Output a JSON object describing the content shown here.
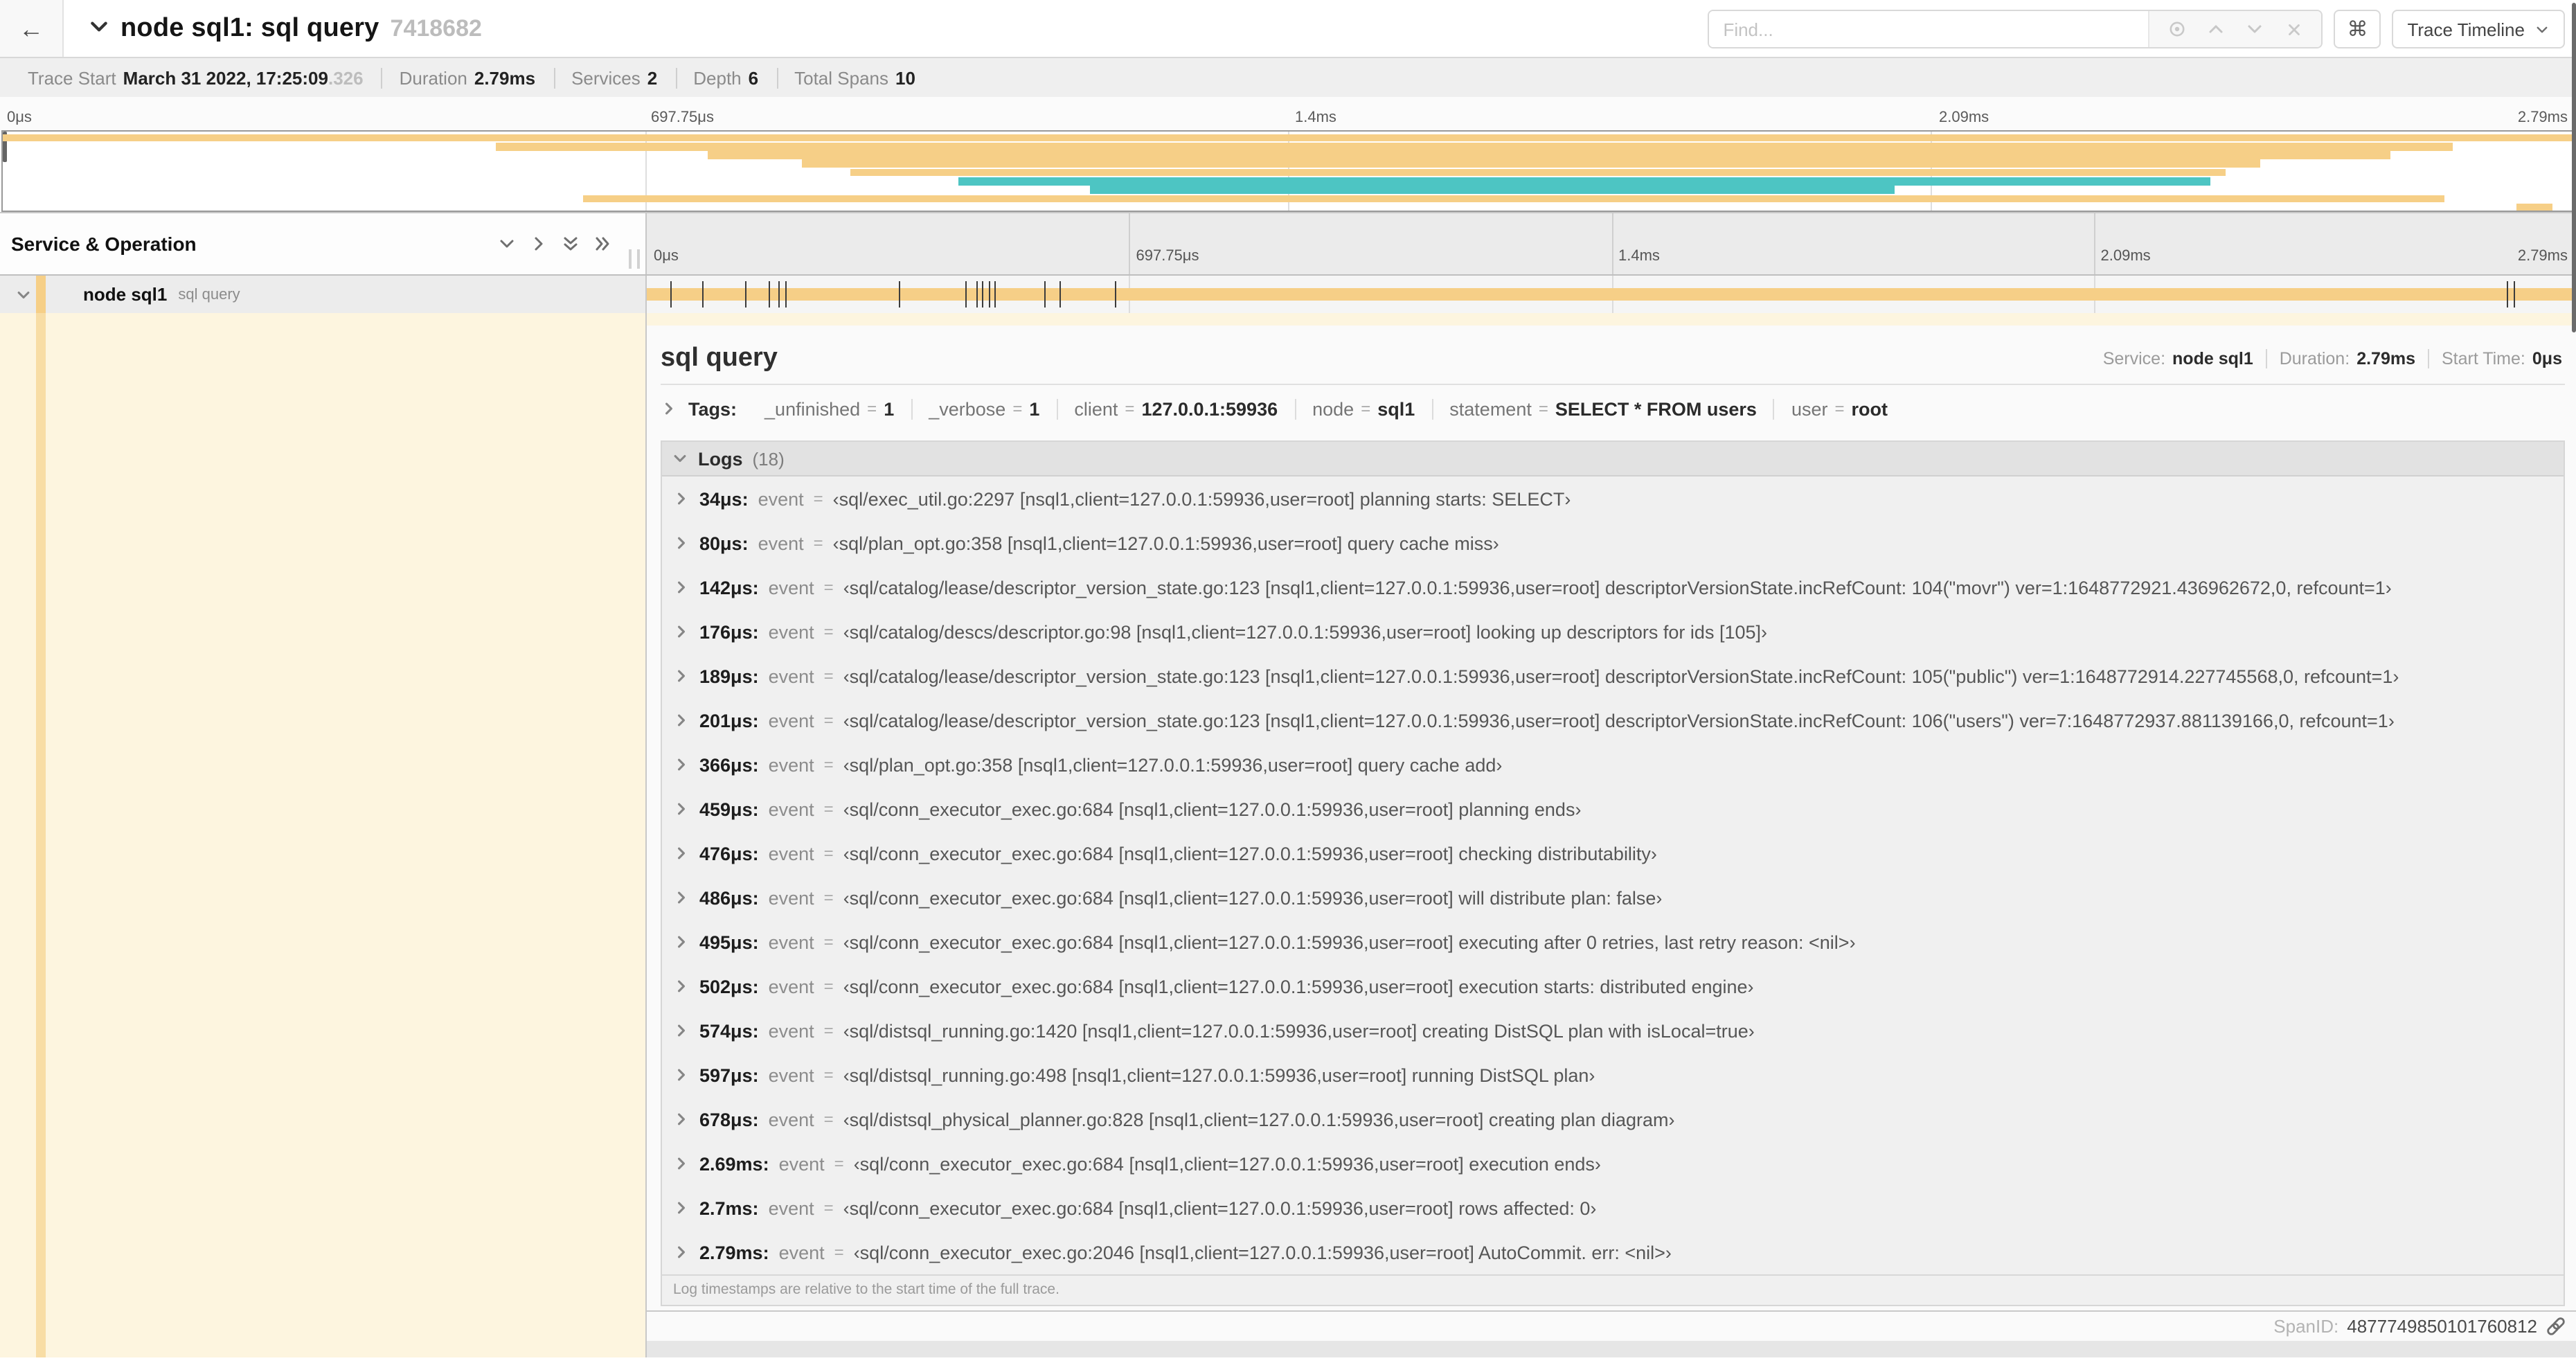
{
  "header": {
    "back_glyph": "←",
    "title": "node sql1: sql query",
    "trace_id_short": "7418682",
    "find_placeholder": "Find...",
    "shortcuts_glyph": "⌘",
    "view_selector": "Trace Timeline"
  },
  "summary": {
    "items": [
      {
        "label": "Trace Start",
        "value": "March 31 2022, 17:25:09",
        "suffix": ".326"
      },
      {
        "label": "Duration",
        "value": "2.79ms",
        "suffix": ""
      },
      {
        "label": "Services",
        "value": "2",
        "suffix": ""
      },
      {
        "label": "Depth",
        "value": "6",
        "suffix": ""
      },
      {
        "label": "Total Spans",
        "value": "10",
        "suffix": ""
      }
    ]
  },
  "colors": {
    "span_orange": "#f6cf87",
    "span_teal": "#4dc5c3",
    "detail_accent": "#f8dda5",
    "detail_bg": "#fdf5df"
  },
  "minimap": {
    "spans": [
      {
        "start": 0,
        "end": 100,
        "color": "#f6cf87"
      },
      {
        "start": 19.2,
        "end": 95.3,
        "color": "#f6cf87"
      },
      {
        "start": 27.4,
        "end": 92.9,
        "color": "#f6cf87"
      },
      {
        "start": 31.1,
        "end": 87.8,
        "color": "#f6cf87"
      },
      {
        "start": 33.0,
        "end": 86.5,
        "color": "#f6cf87"
      },
      {
        "start": 37.2,
        "end": 85.9,
        "color": "#4dc5c3"
      },
      {
        "start": 42.3,
        "end": 73.6,
        "color": "#4dc5c3"
      },
      {
        "start": 22.6,
        "end": 95.0,
        "color": "#f6cf87"
      },
      {
        "start": 97.8,
        "end": 99.2,
        "color": "#f6cf87"
      }
    ]
  },
  "timeline": {
    "left_header": "Service & Operation",
    "ticks": [
      {
        "label": "0μs",
        "pct": 0,
        "align": "left"
      },
      {
        "label": "697.75μs",
        "pct": 25,
        "align": "left"
      },
      {
        "label": "1.4ms",
        "pct": 50,
        "align": "left"
      },
      {
        "label": "2.09ms",
        "pct": 75,
        "align": "left"
      },
      {
        "label": "2.79ms",
        "pct": 100,
        "align": "right"
      }
    ],
    "grid_pcts": [
      25,
      50,
      75
    ],
    "row": {
      "service": "node sql1",
      "operation": "sql query"
    },
    "log_ticks_pct": [
      1.2,
      2.9,
      5.1,
      6.3,
      6.8,
      7.2,
      13.1,
      16.5,
      17.1,
      17.4,
      17.7,
      18.0,
      20.6,
      21.4,
      24.3,
      96.4,
      96.8,
      99.9
    ]
  },
  "detail": {
    "title": "sql query",
    "eq": "=",
    "info": [
      {
        "label": "Service:",
        "value": "node sql1"
      },
      {
        "label": "Duration:",
        "value": "2.79ms"
      },
      {
        "label": "Start Time:",
        "value": "0μs"
      }
    ],
    "tags_label": "Tags:",
    "tags": [
      {
        "key": "_unfinished",
        "value": "1"
      },
      {
        "key": "_verbose",
        "value": "1"
      },
      {
        "key": "client",
        "value": "127.0.0.1:59936"
      },
      {
        "key": "node",
        "value": "sql1"
      },
      {
        "key": "statement",
        "value": "SELECT * FROM users"
      },
      {
        "key": "user",
        "value": "root"
      }
    ],
    "logs_label": "Logs",
    "logs_count": "(18)",
    "log_field_label": "event",
    "logs": [
      {
        "time": "34μs:",
        "value": "‹sql/exec_util.go:2297 [nsql1,client=127.0.0.1:59936,user=root] planning starts: SELECT›"
      },
      {
        "time": "80μs:",
        "value": "‹sql/plan_opt.go:358 [nsql1,client=127.0.0.1:59936,user=root] query cache miss›"
      },
      {
        "time": "142μs:",
        "value": "‹sql/catalog/lease/descriptor_version_state.go:123 [nsql1,client=127.0.0.1:59936,user=root] descriptorVersionState.incRefCount: 104(\"movr\") ver=1:1648772921.436962672,0, refcount=1›"
      },
      {
        "time": "176μs:",
        "value": "‹sql/catalog/descs/descriptor.go:98 [nsql1,client=127.0.0.1:59936,user=root] looking up descriptors for ids [105]›"
      },
      {
        "time": "189μs:",
        "value": "‹sql/catalog/lease/descriptor_version_state.go:123 [nsql1,client=127.0.0.1:59936,user=root] descriptorVersionState.incRefCount: 105(\"public\") ver=1:1648772914.227745568,0, refcount=1›"
      },
      {
        "time": "201μs:",
        "value": "‹sql/catalog/lease/descriptor_version_state.go:123 [nsql1,client=127.0.0.1:59936,user=root] descriptorVersionState.incRefCount: 106(\"users\") ver=7:1648772937.881139166,0, refcount=1›"
      },
      {
        "time": "366μs:",
        "value": "‹sql/plan_opt.go:358 [nsql1,client=127.0.0.1:59936,user=root] query cache add›"
      },
      {
        "time": "459μs:",
        "value": "‹sql/conn_executor_exec.go:684 [nsql1,client=127.0.0.1:59936,user=root] planning ends›"
      },
      {
        "time": "476μs:",
        "value": "‹sql/conn_executor_exec.go:684 [nsql1,client=127.0.0.1:59936,user=root] checking distributability›"
      },
      {
        "time": "486μs:",
        "value": "‹sql/conn_executor_exec.go:684 [nsql1,client=127.0.0.1:59936,user=root] will distribute plan: false›"
      },
      {
        "time": "495μs:",
        "value": "‹sql/conn_executor_exec.go:684 [nsql1,client=127.0.0.1:59936,user=root] executing after 0 retries, last retry reason: <nil>›"
      },
      {
        "time": "502μs:",
        "value": "‹sql/conn_executor_exec.go:684 [nsql1,client=127.0.0.1:59936,user=root] execution starts: distributed engine›"
      },
      {
        "time": "574μs:",
        "value": "‹sql/distsql_running.go:1420 [nsql1,client=127.0.0.1:59936,user=root] creating DistSQL plan with isLocal=true›"
      },
      {
        "time": "597μs:",
        "value": "‹sql/distsql_running.go:498 [nsql1,client=127.0.0.1:59936,user=root] running DistSQL plan›"
      },
      {
        "time": "678μs:",
        "value": "‹sql/distsql_physical_planner.go:828 [nsql1,client=127.0.0.1:59936,user=root] creating plan diagram›"
      },
      {
        "time": "2.69ms:",
        "value": "‹sql/conn_executor_exec.go:684 [nsql1,client=127.0.0.1:59936,user=root] execution ends›"
      },
      {
        "time": "2.7ms:",
        "value": "‹sql/conn_executor_exec.go:684 [nsql1,client=127.0.0.1:59936,user=root] rows affected: 0›"
      },
      {
        "time": "2.79ms:",
        "value": "‹sql/conn_executor_exec.go:2046 [nsql1,client=127.0.0.1:59936,user=root] AutoCommit. err: <nil>›"
      }
    ],
    "logs_note": "Log timestamps are relative to the start time of the full trace.",
    "spanid_label": "SpanID:",
    "spanid": "4877749850101760812"
  }
}
